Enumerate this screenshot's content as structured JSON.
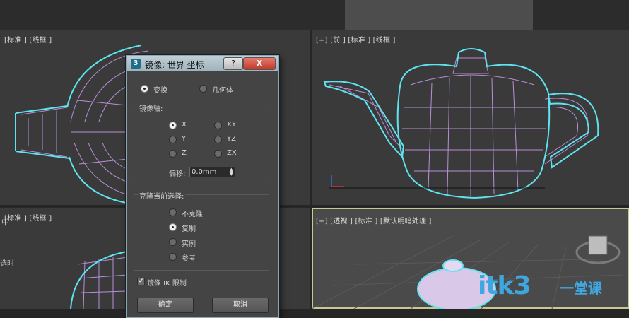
{
  "viewports": {
    "top_left": {
      "label": "[标准 ] [线框 ]"
    },
    "top_right": {
      "label": "[+] [前 ] [标准 ] [线框 ]"
    },
    "bottom_left": {
      "label": "[标准 ] [线框 ]"
    },
    "bottom_right": {
      "label": "[+] [透视 ] [标准 ] [默认明暗处理 ]"
    }
  },
  "side_fragments": [
    "中",
    "选时"
  ],
  "dialog": {
    "icon_text": "3",
    "title": "镜像: 世界 坐标",
    "help_label": "?",
    "close_label": "X",
    "mode": {
      "transform": "变换",
      "geometry": "几何体",
      "selected": "transform"
    },
    "mirror_axis": {
      "title": "镜像轴:",
      "options": [
        "X",
        "Y",
        "Z",
        "XY",
        "YZ",
        "ZX"
      ],
      "selected": "X"
    },
    "offset": {
      "label": "偏移:",
      "value": "0.0mm"
    },
    "clone": {
      "title": "克隆当前选择:",
      "options": [
        "不克隆",
        "复制",
        "实例",
        "参考"
      ],
      "selected": "复制"
    },
    "mirror_ik": {
      "label": "镜像 IK 限制",
      "checked": true
    },
    "ok_label": "确定",
    "cancel_label": "取消"
  },
  "watermark": {
    "main": "itk3",
    "suffix": "一堂课"
  },
  "colors": {
    "wire_outline": "#5fe3f0",
    "wire_mesh": "#b88fd8",
    "viewport_bg": "#3a3a3a"
  }
}
